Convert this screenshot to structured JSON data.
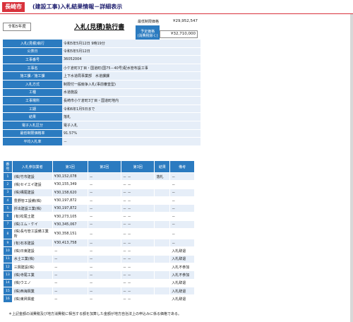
{
  "header": {
    "city": "長崎市",
    "title": "(建設工事)入札結果情報－詳細表示"
  },
  "era_label": "令和5年度",
  "doc_title": "入札(見積)執行書",
  "prices": {
    "min_limit_label": "最低制限価格",
    "min_limit_value": "¥29,952,547",
    "estimate_label_1": "予定価格",
    "estimate_label_2": "(消費税除く)",
    "estimate_value": "¥32,710,000"
  },
  "info_rows": [
    {
      "label": "入札(見積)執行",
      "value": "令和5年5月12日 9時19分"
    },
    {
      "label": "公表日",
      "value": "令和5年5月12日"
    },
    {
      "label": "工事番号",
      "value": "36052004"
    },
    {
      "label": "工事名",
      "value": "小ケ倉町3丁目・国道町(国75－40号)配水管布設工事"
    },
    {
      "label": "施工課／施工課",
      "value": "上下水道局事業部　水道課課"
    },
    {
      "label": "入札方式",
      "value": "制限付一般競争入札(事前審査型)"
    },
    {
      "label": "工種",
      "value": "水道施設"
    },
    {
      "label": "工事場所",
      "value": "長崎市小ケ倉町3丁目・国道町地内"
    },
    {
      "label": "工期",
      "value": "令和6年1月5日まで"
    },
    {
      "label": "結果",
      "value": "落札"
    },
    {
      "label": "電子入札区分",
      "value": "電子入札"
    },
    {
      "label": "最低制限価格率",
      "value": "91.57%"
    },
    {
      "label": "平均入札率",
      "value": "－"
    }
  ],
  "bid_table": {
    "headers": [
      "番号",
      "入札参加業者",
      "第1回",
      "第2回",
      "第3回",
      "結果",
      "備考"
    ],
    "rows": [
      {
        "no": "1",
        "name": "(株)竹市建設",
        "r1": "¥30,152,078",
        "r2": "－",
        "r3": "－ －",
        "result": "落札",
        "note": "－"
      },
      {
        "no": "2",
        "name": "(株)セイエイ建設",
        "r1": "¥30,155,349",
        "r2": "－",
        "r3": "－ －",
        "result": "",
        "note": "－"
      },
      {
        "no": "3",
        "name": "(株)構尾建設",
        "r1": "¥30,158,620",
        "r2": "－",
        "r3": "－ －",
        "result": "",
        "note": "－"
      },
      {
        "no": "4",
        "name": "豊野管工設備(株)",
        "r1": "¥30,197,872",
        "r2": "－",
        "r3": "－ －",
        "result": "",
        "note": "－"
      },
      {
        "no": "5",
        "name": "折出建設工業(株)",
        "r1": "¥30,197,872",
        "r2": "－",
        "r3": "－ －",
        "result": "",
        "note": "－"
      },
      {
        "no": "6",
        "name": "(有)松尾土建",
        "r1": "¥30,273,105",
        "r2": "－",
        "r3": "－ －",
        "result": "",
        "note": "－"
      },
      {
        "no": "7",
        "name": "(株)エム・ケイ",
        "r1": "¥30,345,067",
        "r2": "－",
        "r3": "－ －",
        "result": "",
        "note": "－"
      },
      {
        "no": "8",
        "name": "(株)長与管工設備工業所",
        "r1": "¥30,358,151",
        "r2": "－",
        "r3": "－ －",
        "result": "",
        "note": "－"
      },
      {
        "no": "9",
        "name": "(有)石本建設",
        "r1": "¥30,413,758",
        "r2": "－",
        "r3": "－ －",
        "result": "",
        "note": "－"
      },
      {
        "no": "10",
        "name": "(株)日東建設",
        "r1": "－",
        "r2": "－",
        "r3": "－ －",
        "result": "",
        "note": "入札辞退"
      },
      {
        "no": "11",
        "name": "水士工業(株)",
        "r1": "－",
        "r2": "－",
        "r3": "－ －",
        "result": "",
        "note": "入札辞退"
      },
      {
        "no": "12",
        "name": "三興建設(株)",
        "r1": "－",
        "r2": "－",
        "r3": "－ －",
        "result": "",
        "note": "入札不参加"
      },
      {
        "no": "13",
        "name": "(株)寺尾工業",
        "r1": "－",
        "r2": "－",
        "r3": "－ －",
        "result": "",
        "note": "入札不参加"
      },
      {
        "no": "14",
        "name": "(株)ウエノ",
        "r1": "－",
        "r2": "－",
        "r3": "－ －",
        "result": "",
        "note": "入札辞退"
      },
      {
        "no": "15",
        "name": "(株)西海興業",
        "r1": "－",
        "r2": "－",
        "r3": "－ －",
        "result": "",
        "note": "入札辞退"
      },
      {
        "no": "16",
        "name": "(株)東昇興産",
        "r1": "－",
        "r2": "－",
        "r3": "－ －",
        "result": "",
        "note": "入札辞退"
      }
    ]
  },
  "footnote": "＊上記金額の消費税及び地方消費税に相当する額を加算した金額が地方自治法上の申込みに係る価格である。",
  "colors": {
    "brand_red": "#d8323c",
    "header_blue": "#2b7bc0",
    "row_tint": "#e6eef8"
  }
}
